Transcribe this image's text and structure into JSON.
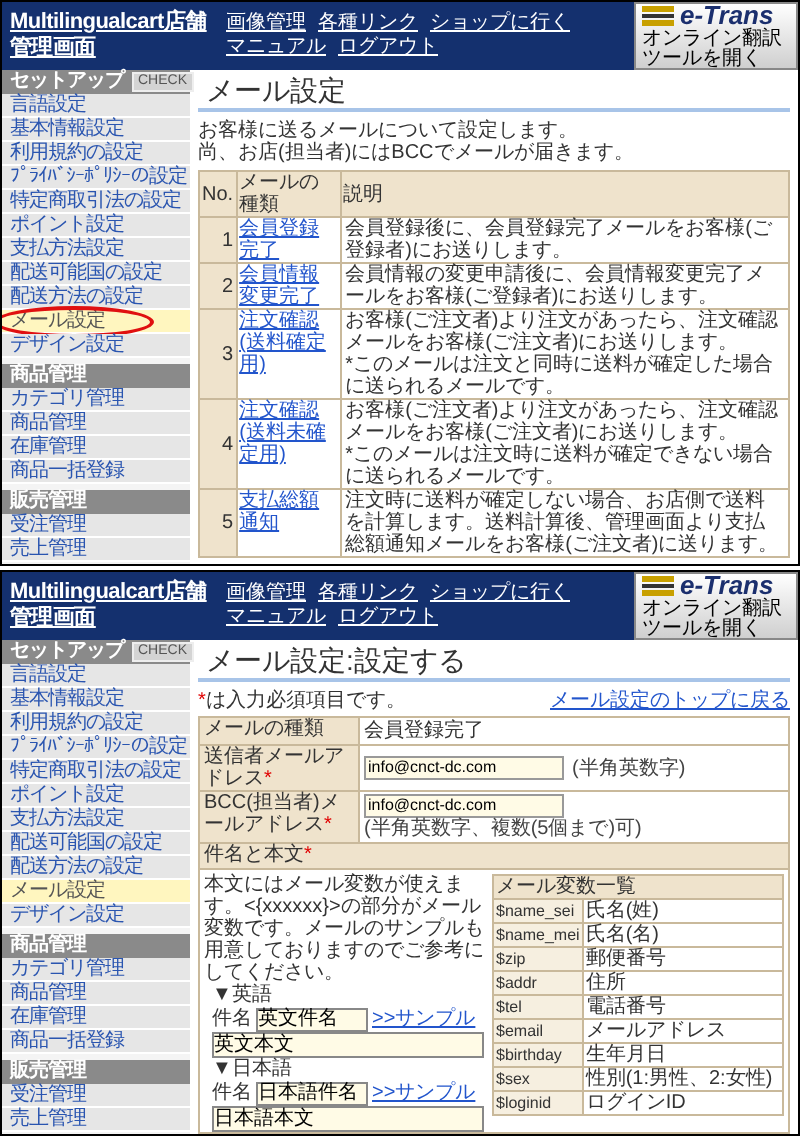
{
  "screens": [
    {
      "kind": "list",
      "header": {
        "title": "Multilingualcart店舗管理画面",
        "links": [
          "画像管理",
          "各種リンク",
          "ショップに行く",
          "マニュアル",
          "ログアウト"
        ],
        "logo": "e-Trans",
        "logo_caption": "オンライン翻訳ツールを開く"
      },
      "sidebar": [
        {
          "title": "セットアップ",
          "badge": "CHECK",
          "items": [
            {
              "label": "言語設定",
              "selected": false,
              "circled": false
            },
            {
              "label": "基本情報設定",
              "selected": false,
              "circled": false
            },
            {
              "label": "利用規約の設定",
              "selected": false,
              "circled": false
            },
            {
              "label": "ﾌﾟﾗｲﾊﾞｼｰﾎﾟﾘｼｰの設定",
              "selected": false,
              "circled": false
            },
            {
              "label": "特定商取引法の設定",
              "selected": false,
              "circled": false
            },
            {
              "label": "ポイント設定",
              "selected": false,
              "circled": false
            },
            {
              "label": "支払方法設定",
              "selected": false,
              "circled": false
            },
            {
              "label": "配送可能国の設定",
              "selected": false,
              "circled": false
            },
            {
              "label": "配送方法の設定",
              "selected": false,
              "circled": false
            },
            {
              "label": "メール設定",
              "selected": true,
              "circled": true
            },
            {
              "label": "デザイン設定",
              "selected": false,
              "circled": false
            }
          ]
        },
        {
          "title": "商品管理",
          "items": [
            {
              "label": "カテゴリ管理",
              "selected": false,
              "circled": false
            },
            {
              "label": "商品管理",
              "selected": false,
              "circled": false
            },
            {
              "label": "在庫管理",
              "selected": false,
              "circled": false
            },
            {
              "label": "商品一括登録",
              "selected": false,
              "circled": false
            }
          ]
        },
        {
          "title": "販売管理",
          "items": [
            {
              "label": "受注管理",
              "selected": false,
              "circled": false
            },
            {
              "label": "売上管理",
              "selected": false,
              "circled": false
            }
          ]
        }
      ],
      "page_title": "メール設定",
      "intro": [
        "お客様に送るメールについて設定します。",
        "尚、お店(担当者)にはBCCでメールが届きます。"
      ],
      "table": {
        "columns": [
          "No.",
          "メールの種類",
          "説明"
        ],
        "rows": [
          {
            "no": "1",
            "type": "会員登録完了",
            "description": [
              "会員登録後に、会員登録完了メールをお客様(ご登録者)にお送りします。"
            ]
          },
          {
            "no": "2",
            "type": "会員情報変更完了",
            "description": [
              "会員情報の変更申請後に、会員情報変更完了メールをお客様(ご登録者)にお送りします。"
            ]
          },
          {
            "no": "3",
            "type": "注文確認(送料確定用)",
            "description": [
              "お客様(ご注文者)より注文があったら、注文確認メールをお客様(ご注文者)にお送りします。",
              "*このメールは注文と同時に送料が確定した場合に送られるメールです。"
            ]
          },
          {
            "no": "4",
            "type": "注文確認(送料未確定用)",
            "description": [
              "お客様(ご注文者)より注文があったら、注文確認メールをお客様(ご注文者)にお送りします。",
              "*このメールは注文時に送料が確定できない場合に送られるメールです。"
            ]
          },
          {
            "no": "5",
            "type": "支払総額通知",
            "description": [
              "注文時に送料が確定しない場合、お店側で送料を計算します。送料計算後、管理画面より支払総額通知メールをお客様(ご注文者)に送ります。"
            ]
          }
        ]
      }
    },
    {
      "kind": "form",
      "header": {
        "title": "Multilingualcart店舗管理画面",
        "links": [
          "画像管理",
          "各種リンク",
          "ショップに行く",
          "マニュアル",
          "ログアウト"
        ],
        "logo": "e-Trans",
        "logo_caption": "オンライン翻訳ツールを開く"
      },
      "sidebar": [
        {
          "title": "セットアップ",
          "badge": "CHECK",
          "items": [
            {
              "label": "言語設定",
              "selected": false
            },
            {
              "label": "基本情報設定",
              "selected": false
            },
            {
              "label": "利用規約の設定",
              "selected": false
            },
            {
              "label": "ﾌﾟﾗｲﾊﾞｼｰﾎﾟﾘｼｰの設定",
              "selected": false
            },
            {
              "label": "特定商取引法の設定",
              "selected": false
            },
            {
              "label": "ポイント設定",
              "selected": false
            },
            {
              "label": "支払方法設定",
              "selected": false
            },
            {
              "label": "配送可能国の設定",
              "selected": false
            },
            {
              "label": "配送方法の設定",
              "selected": false
            },
            {
              "label": "メール設定",
              "selected": true
            },
            {
              "label": "デザイン設定",
              "selected": false
            }
          ]
        },
        {
          "title": "商品管理",
          "items": [
            {
              "label": "カテゴリ管理",
              "selected": false
            },
            {
              "label": "商品管理",
              "selected": false
            },
            {
              "label": "在庫管理",
              "selected": false
            },
            {
              "label": "商品一括登録",
              "selected": false
            }
          ]
        },
        {
          "title": "販売管理",
          "items": [
            {
              "label": "受注管理",
              "selected": false
            },
            {
              "label": "売上管理",
              "selected": false
            }
          ]
        }
      ],
      "page_title": "メール設定:設定する",
      "back_link": "メール設定のトップに戻る",
      "required_note": {
        "mark": "*",
        "text": "は入力必須項目です。"
      },
      "fields": [
        {
          "kind": "text",
          "label": "メールの種類",
          "value": "会員登録完了"
        },
        {
          "kind": "input",
          "label": "送信者メールアドレス",
          "required_mark": "*",
          "value": "info@cnct-dc.com",
          "hint": "(半角英数字)"
        },
        {
          "kind": "input",
          "label": "BCC(担当者)メールアドレス",
          "required_mark": "*",
          "value": "info@cnct-dc.com",
          "hint": "(半角英数字、複数(5個まで)可)"
        }
      ],
      "body_section": {
        "title": "件名と本文",
        "required_mark": "*",
        "note": "本文にはメール変数が使えます。<{xxxxxx}>の部分がメール変数です。メールのサンプルも用意しておりますのでご参考にしてください。",
        "languages": [
          {
            "heading": "▼英語",
            "subject_label": "件名",
            "subject": "英文件名",
            "sample_link": ">>サンプル",
            "body": "英文本文"
          },
          {
            "heading": "▼日本語",
            "subject_label": "件名",
            "subject": "日本語件名",
            "sample_link": ">>サンプル",
            "body": "日本語本文"
          }
        ],
        "variables": {
          "title": "メール変数一覧",
          "rows": [
            {
              "name": "$name_sei",
              "meaning": "氏名(姓)"
            },
            {
              "name": "$name_mei",
              "meaning": "氏名(名)"
            },
            {
              "name": "$zip",
              "meaning": "郵便番号"
            },
            {
              "name": "$addr",
              "meaning": "住所"
            },
            {
              "name": "$tel",
              "meaning": "電話番号"
            },
            {
              "name": "$email",
              "meaning": "メールアドレス"
            },
            {
              "name": "$birthday",
              "meaning": "生年月日"
            },
            {
              "name": "$sex",
              "meaning": "性別(1:男性、2:女性)"
            },
            {
              "name": "$loginid",
              "meaning": "ログインID"
            }
          ]
        }
      }
    }
  ]
}
